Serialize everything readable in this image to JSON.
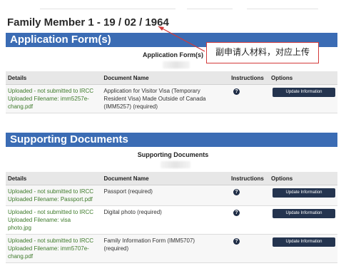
{
  "member_title": "Family Member 1 - 19 / 02 / 1964",
  "application": {
    "bar_title": "Application Form(s)",
    "caption": "Application Form(s)",
    "headers": {
      "details": "Details",
      "doc": "Document Name",
      "instr": "Instructions",
      "options": "Options"
    },
    "rows": [
      {
        "status": "Uploaded - not submitted to IRCC",
        "filename_lines": [
          "Uploaded Filename:  imm5257e-",
          "chang.pdf"
        ],
        "doc_lines": [
          "Application for Visitor Visa (Temporary",
          "Resident Visa) Made Outside of Canada",
          "(IMM5257)  (required)"
        ],
        "button": "Update Information"
      }
    ]
  },
  "supporting": {
    "bar_title": "Supporting Documents",
    "caption": "Supporting Documents",
    "headers": {
      "details": "Details",
      "doc": "Document Name",
      "instr": "Instructions",
      "options": "Options"
    },
    "rows": [
      {
        "status": "Uploaded - not submitted to IRCC",
        "filename_lines": [
          "Uploaded Filename:  Passport.pdf"
        ],
        "doc_lines": [
          "Passport  (required)"
        ],
        "button": "Update Information"
      },
      {
        "status": "Uploaded - not submitted to IRCC",
        "filename_lines": [
          "Uploaded Filename:  visa",
          "photo.jpg"
        ],
        "doc_lines": [
          "Digital photo  (required)"
        ],
        "button": "Update Information"
      },
      {
        "status": "Uploaded - not submitted to IRCC",
        "filename_lines": [
          "Uploaded Filename:  imm5707e-",
          "chang.pdf"
        ],
        "doc_lines": [
          "Family Information Form (IMM5707)",
          " (required)"
        ],
        "button": "Update Information"
      }
    ]
  },
  "annotation": {
    "text": "副申请人材料，对应上传",
    "color": "#d33a3a"
  },
  "info_icon_glyph": "?"
}
